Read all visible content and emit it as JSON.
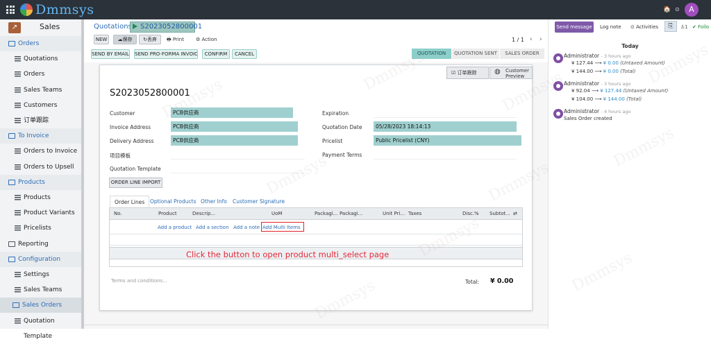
{
  "topbar": {
    "logo_text": "Dmmsys",
    "icon_globe": "🏠",
    "icon_chat": "✱",
    "icon_clock": "⊙",
    "icon_moon": "☾",
    "avatar_letter": "A"
  },
  "sidebar": {
    "app_title": "Sales",
    "items": [
      {
        "label": "Orders",
        "kind": "group"
      },
      {
        "label": "Quotations",
        "kind": "sub"
      },
      {
        "label": "Orders",
        "kind": "sub"
      },
      {
        "label": "Sales Teams",
        "kind": "sub"
      },
      {
        "label": "Customers",
        "kind": "sub"
      },
      {
        "label": "订单跟踪",
        "kind": "sub"
      },
      {
        "label": "To Invoice",
        "kind": "group"
      },
      {
        "label": "Orders to Invoice",
        "kind": "sub"
      },
      {
        "label": "Orders to Upsell",
        "kind": "sub"
      },
      {
        "label": "Products",
        "kind": "group"
      },
      {
        "label": "Products",
        "kind": "sub"
      },
      {
        "label": "Product Variants",
        "kind": "sub"
      },
      {
        "label": "Pricelists",
        "kind": "sub"
      },
      {
        "label": "Reporting",
        "kind": "root"
      },
      {
        "label": "Configuration",
        "kind": "group"
      },
      {
        "label": "Settings",
        "kind": "sub"
      },
      {
        "label": "Sales Teams",
        "kind": "sub"
      },
      {
        "label": "Sales Orders",
        "kind": "sel"
      },
      {
        "label": "Quotation Template",
        "kind": "sub"
      }
    ]
  },
  "breadcrumb": {
    "parent": "Quotations",
    "current": "S2023052800001"
  },
  "toolbar": {
    "new": "NEW",
    "save": "保存",
    "discard": "丢弃",
    "print": "Print",
    "action": "Action",
    "pager": "1 / 1"
  },
  "actions": {
    "send_email": "SEND BY EMAIL",
    "send_proforma": "SEND PRO-FORMA INVOICE",
    "confirm": "CONFIRM",
    "cancel": "CANCEL"
  },
  "statusbar": {
    "quotation": "QUOTATION",
    "quotation_sent": "QUOTATION SENT",
    "sales_order": "SALES ORDER"
  },
  "smart_buttons": {
    "tracking": "订单跟踪",
    "customer_preview_1": "Customer",
    "customer_preview_2": "Preview"
  },
  "form": {
    "title": "S2023052800001",
    "customer_label": "Customer",
    "customer_value": "PCB供应商",
    "invoice_label": "Invoice Address",
    "invoice_value": "PCB供应商",
    "delivery_label": "Delivery Address",
    "delivery_value": "PCB供应商",
    "project_label": "项目模板",
    "project_value": "",
    "template_label": "Quotation Template",
    "template_value": "",
    "expiration_label": "Expiration",
    "expiration_value": "",
    "date_label": "Quotation Date",
    "date_value": "05/28/2023 18:14:13",
    "pricelist_label": "Pricelist",
    "pricelist_value": "Public Pricelist (CNY)",
    "payment_label": "Payment Terms",
    "payment_value": "",
    "oli_button": "ORDER LINE IMPORT"
  },
  "tabs": [
    "Order Lines",
    "Optional Products",
    "Other Info",
    "Customer Signature"
  ],
  "table": {
    "headers": [
      "No.",
      "Product",
      "Descrip...",
      "UoM",
      "Packagi...",
      "Packagi...",
      "Unit Pri...",
      "Taxes",
      "Disc.%",
      "Subtot..."
    ],
    "add_product": "Add a product",
    "add_section": "Add a section",
    "add_note": "Add a note",
    "add_multi": "Add Multi Items"
  },
  "annotation": "Click the button to open product multi_select page",
  "terms_placeholder": "Terms and conditions...",
  "total_label": "Total:",
  "total_value": "¥ 0.00",
  "chatter": {
    "send": "Send message",
    "log": "Log note",
    "activities": "Activities",
    "followers": "1",
    "follow": "Follo",
    "today": "Today",
    "messages": [
      {
        "author": "Administrator",
        "time": "- 3 hours ago",
        "lines": [
          [
            "¥ 127.44",
            "¥ 0.00",
            "(Untaxed Amount)"
          ],
          [
            "¥ 144.00",
            "¥ 0.00",
            "(Total)"
          ]
        ]
      },
      {
        "author": "Administrator",
        "time": "- 3 hours ago",
        "lines": [
          [
            "¥ 92.04",
            "¥ 127.44",
            "(Untaxed Amount)"
          ],
          [
            "¥ 104.00",
            "¥ 144.00",
            "(Total)"
          ]
        ]
      },
      {
        "author": "Administrator",
        "time": "- 4 hours ago",
        "text": "Sales Order created"
      }
    ]
  },
  "watermark": "Dmmsys"
}
